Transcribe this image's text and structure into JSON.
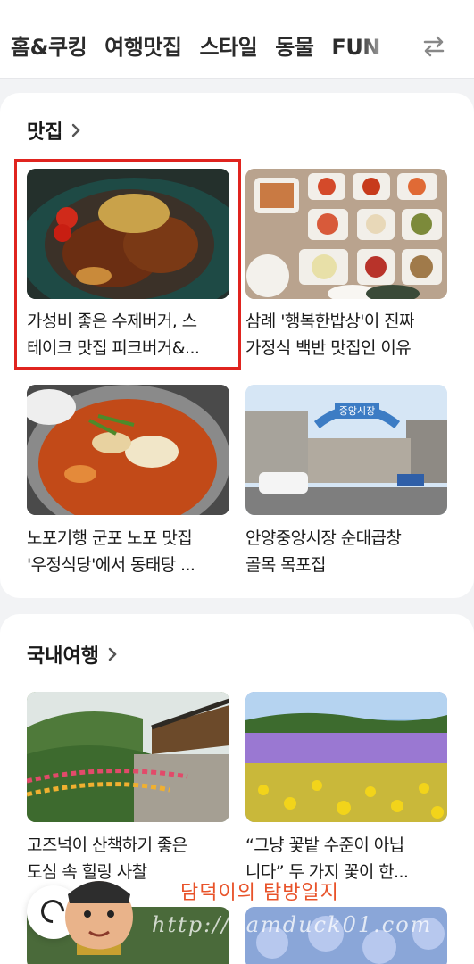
{
  "tabs": [
    "홈&쿠킹",
    "여행맛집",
    "스타일",
    "동물",
    "FUN"
  ],
  "sections": {
    "food": {
      "title": "맛집",
      "items": [
        {
          "line1": "가성비 좋은 수제버거, 스",
          "line2": "테이크 맛집 피크버거&..."
        },
        {
          "line1": "삼례 '행복한밥상'이 진짜",
          "line2": "가정식 백반 맛집인 이유"
        },
        {
          "line1": "노포기행 군포 노포 맛집",
          "line2": "'우정식당'에서 동태탕 ..."
        },
        {
          "line1": "안양중앙시장 순대곱창",
          "line2": "골목 목포집"
        }
      ]
    },
    "travel": {
      "title": "국내여행",
      "items": [
        {
          "line1": "고즈넉이 산책하기 좋은",
          "line2": "도심 속 힐링 사찰"
        },
        {
          "line1": "“그냥 꽃밭 수준이 아닙",
          "line2": "니다” 두 가지 꽃이 한..."
        }
      ]
    }
  },
  "market_sign": "중앙시장",
  "watermark": {
    "title": "담덕이의 탐방일지",
    "url": "http://damduck01.com"
  },
  "colors": {
    "accent_red": "#e0241f",
    "watermark": "#e8532a"
  }
}
